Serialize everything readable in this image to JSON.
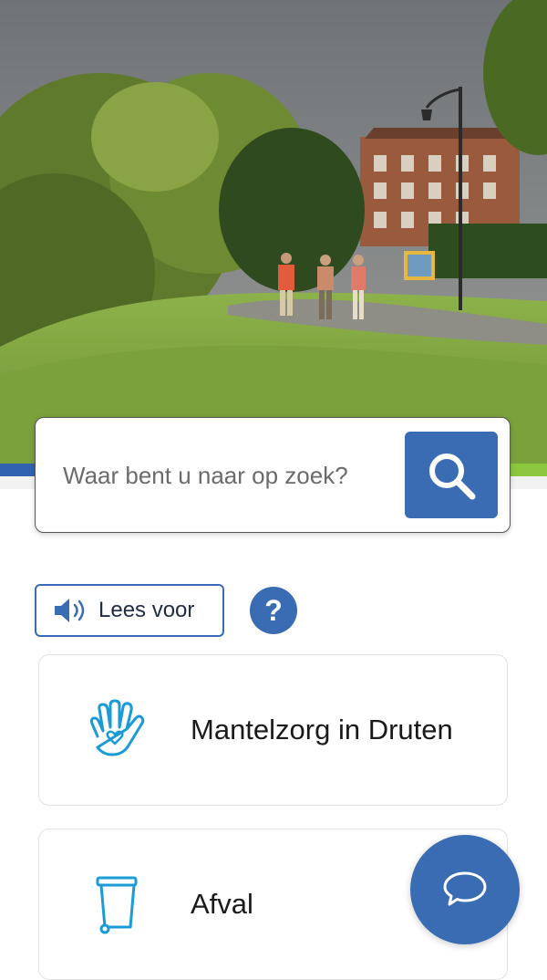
{
  "hero": {
    "image_description_icon": "landscape-photo"
  },
  "search": {
    "placeholder": "Waar bent u naar op zoek?",
    "button_icon": "search-icon"
  },
  "accessibility": {
    "read_aloud_label": "Lees voor",
    "read_aloud_icon": "speaker-icon",
    "help_label": "?"
  },
  "cards": [
    {
      "label": "Mantelzorg in Druten",
      "icon": "hand-heart-icon"
    },
    {
      "label": "Afval",
      "icon": "waste-bin-icon"
    }
  ],
  "chat": {
    "icon": "chat-bubble-icon"
  },
  "colors": {
    "primary": "#3a6cb4",
    "accent_green": "#8dc63f",
    "icon_cyan": "#1a9bd7"
  }
}
